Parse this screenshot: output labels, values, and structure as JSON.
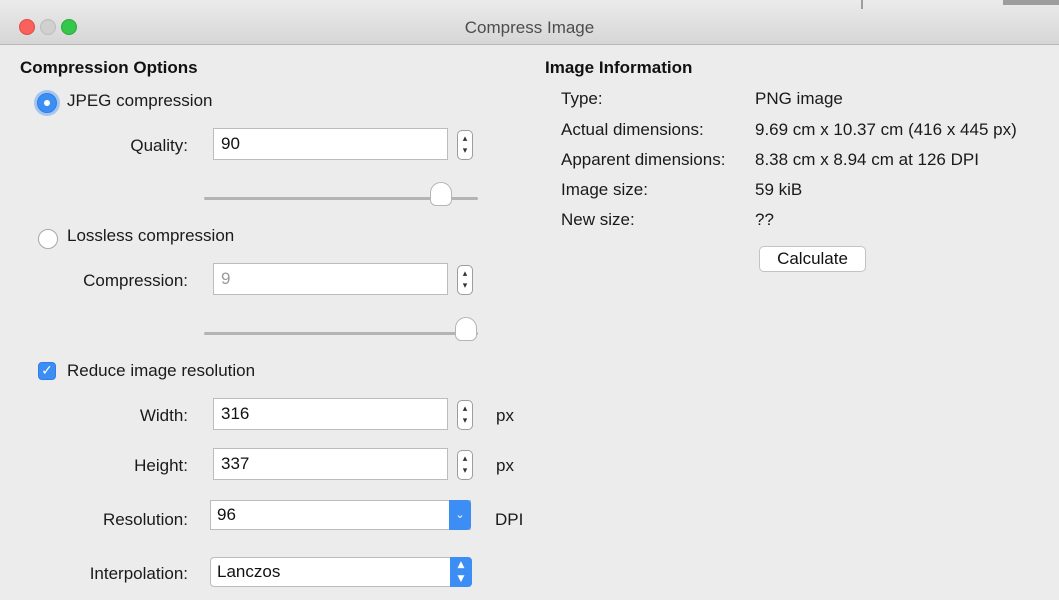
{
  "window": {
    "title": "Compress Image"
  },
  "compression": {
    "heading": "Compression Options",
    "jpeg_label": "JPEG compression",
    "jpeg_selected": true,
    "quality_label": "Quality:",
    "quality_value": "90",
    "quality_slider_fraction": 0.9,
    "lossless_label": "Lossless compression",
    "lossless_selected": false,
    "compression_label": "Compression:",
    "compression_value": "9",
    "compression_slider_fraction": 1.0
  },
  "resolution": {
    "checkbox_label": "Reduce image resolution",
    "checked": true,
    "width_label": "Width:",
    "width_value": "316",
    "width_unit": "px",
    "height_label": "Height:",
    "height_value": "337",
    "height_unit": "px",
    "resolution_label": "Resolution:",
    "resolution_value": "96",
    "resolution_unit": "DPI",
    "interpolation_label": "Interpolation:",
    "interpolation_value": "Lanczos"
  },
  "info": {
    "heading": "Image Information",
    "rows": [
      {
        "label": "Type:",
        "value": "PNG image"
      },
      {
        "label": "Actual dimensions:",
        "value": "9.69 cm x 10.37 cm (416 x 445 px)"
      },
      {
        "label": "Apparent dimensions:",
        "value": "8.38 cm x 8.94 cm at 126 DPI"
      },
      {
        "label": "Image size:",
        "value": "59 kiB"
      },
      {
        "label": "New size:",
        "value": "??"
      }
    ],
    "calculate_label": "Calculate"
  },
  "colors": {
    "accent": "#3d8ef4",
    "close": "#fc605b",
    "maximize": "#34c749"
  }
}
